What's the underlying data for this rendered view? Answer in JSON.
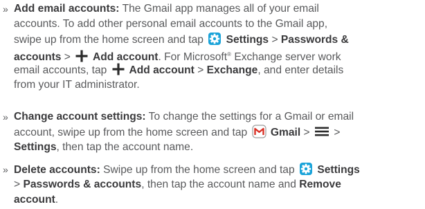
{
  "bullet": "»",
  "items": [
    {
      "lines": [
        [
          {
            "b": "Add email accounts:"
          },
          {
            "t": " The Gmail app manages all of your email"
          }
        ],
        [
          {
            "t": "accounts. To add other personal email accounts to the Gmail app,"
          }
        ],
        [
          {
            "t": "swipe up from the home screen and tap "
          },
          {
            "i": "settings-icon"
          },
          {
            "b": " Settings"
          },
          {
            "t": " > "
          },
          {
            "b": "Passwords &"
          }
        ],
        [
          {
            "b": "accounts"
          },
          {
            "t": " > "
          },
          {
            "i": "plus-icon"
          },
          {
            "b": " Add account"
          },
          {
            "t": ". For Microsoft"
          },
          {
            "s": "®"
          },
          {
            "t": " Exchange server work"
          }
        ],
        [
          {
            "t": "email accounts, tap "
          },
          {
            "i": "plus-icon"
          },
          {
            "b": " Add account"
          },
          {
            "t": " > "
          },
          {
            "b": "Exchange"
          },
          {
            "t": ", and enter details"
          }
        ],
        [
          {
            "t": "from your IT administrator."
          }
        ]
      ]
    },
    {
      "lines": [
        [
          {
            "b": "Change account settings:"
          },
          {
            "t": " To change the settings for a Gmail or email"
          }
        ],
        [
          {
            "t": "account, swipe up from the home screen and tap "
          },
          {
            "i": "gmail-icon"
          },
          {
            "b": " Gmail"
          },
          {
            "t": " > "
          },
          {
            "i": "menu-icon"
          },
          {
            "t": " >"
          }
        ],
        [
          {
            "b": "Settings"
          },
          {
            "t": ", then tap the account name."
          }
        ]
      ]
    },
    {
      "lines": [
        [
          {
            "b": "Delete accounts:"
          },
          {
            "t": " Swipe up from the home screen and tap "
          },
          {
            "i": "settings-icon"
          },
          {
            "b": " Settings"
          }
        ],
        [
          {
            "t": "> "
          },
          {
            "b": "Passwords & accounts"
          },
          {
            "t": ", then tap the account name and "
          },
          {
            "b": "Remove"
          }
        ],
        [
          {
            "b": "account"
          },
          {
            "t": "."
          }
        ]
      ]
    }
  ],
  "colors": {
    "text": "#58595b",
    "bold": "#3a3a3c",
    "settings_icon": "#1aa3d9",
    "gmail_red": "#d93025",
    "icon_dark": "#2b2b2b"
  }
}
